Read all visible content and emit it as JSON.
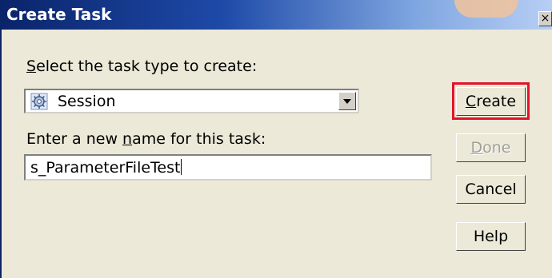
{
  "window": {
    "title": "Create Task",
    "close_glyph": "×"
  },
  "form": {
    "task_type_label_accel": "S",
    "task_type_label_rest": "elect the task type to create:",
    "task_type_value": "Session",
    "task_type_icon": "session-icon",
    "name_label_pre": "Enter a new ",
    "name_label_accel": "n",
    "name_label_post": "ame for this task:",
    "name_value": "s_ParameterFileTest"
  },
  "buttons": {
    "create_accel": "C",
    "create_rest": "reate",
    "done_accel": "D",
    "done_rest": "one",
    "cancel": "Cancel",
    "help": "Help"
  },
  "colors": {
    "titlebar": "#0a246a",
    "highlight": "#e3132b",
    "dialog_bg": "#ece9d8"
  }
}
